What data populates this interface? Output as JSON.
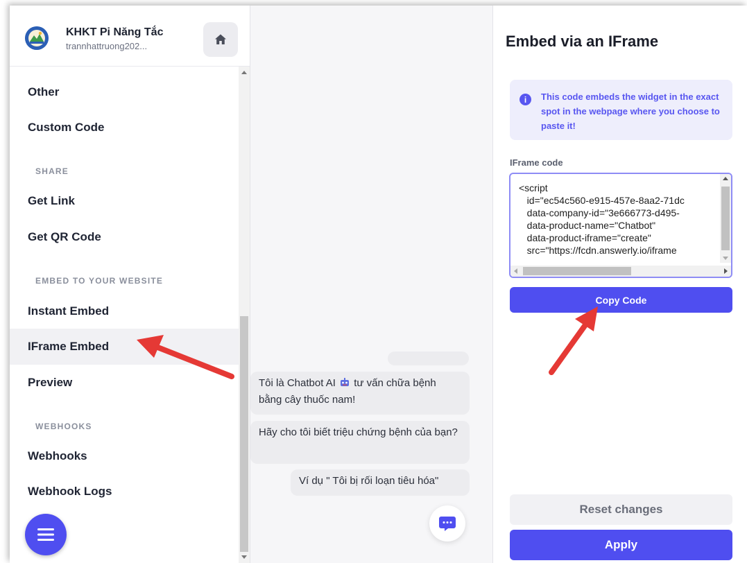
{
  "sidebar": {
    "org_name": "KHKT Pi Năng Tắc",
    "org_user": "trannhattruong202...",
    "items": [
      {
        "label": "Other",
        "kind": "item"
      },
      {
        "label": "Custom Code",
        "kind": "item"
      },
      {
        "label": "SHARE",
        "kind": "section"
      },
      {
        "label": "Get Link",
        "kind": "item"
      },
      {
        "label": "Get QR Code",
        "kind": "item"
      },
      {
        "label": "EMBED TO YOUR WEBSITE",
        "kind": "section"
      },
      {
        "label": "Instant Embed",
        "kind": "item"
      },
      {
        "label": "IFrame Embed",
        "kind": "item",
        "active": true
      },
      {
        "label": "Preview",
        "kind": "item"
      },
      {
        "label": "WEBHOOKS",
        "kind": "section"
      },
      {
        "label": "Webhooks",
        "kind": "item"
      },
      {
        "label": "Webhook Logs",
        "kind": "item"
      }
    ]
  },
  "chat": {
    "messages": [
      {
        "before": "Tôi là Chatbot AI",
        "after": "tư vấn chữa bệnh bằng cây thuốc nam!"
      },
      {
        "text": "Hãy cho tôi biết triệu chứng bệnh của bạn?"
      },
      {
        "text": "Ví dụ \" Tôi bị rối loạn tiêu hóa\""
      }
    ]
  },
  "panel": {
    "title": "Embed via an IFrame",
    "info": "This code embeds the widget in the exact spot in the webpage where you choose to paste it!",
    "code_label": "IFrame code",
    "code": "<script\n   id=\"ec54c560-e915-457e-8aa2-71dc\n   data-company-id=\"3e666773-d495-\n   data-product-name=\"Chatbot\"\n   data-product-iframe=\"create\"\n   src=\"https://fcdn.answerly.io/iframe",
    "copy_label": "Copy Code",
    "reset_label": "Reset changes",
    "apply_label": "Apply"
  },
  "colors": {
    "accent": "#4f4ef0",
    "annotation_arrow": "#e53935"
  }
}
